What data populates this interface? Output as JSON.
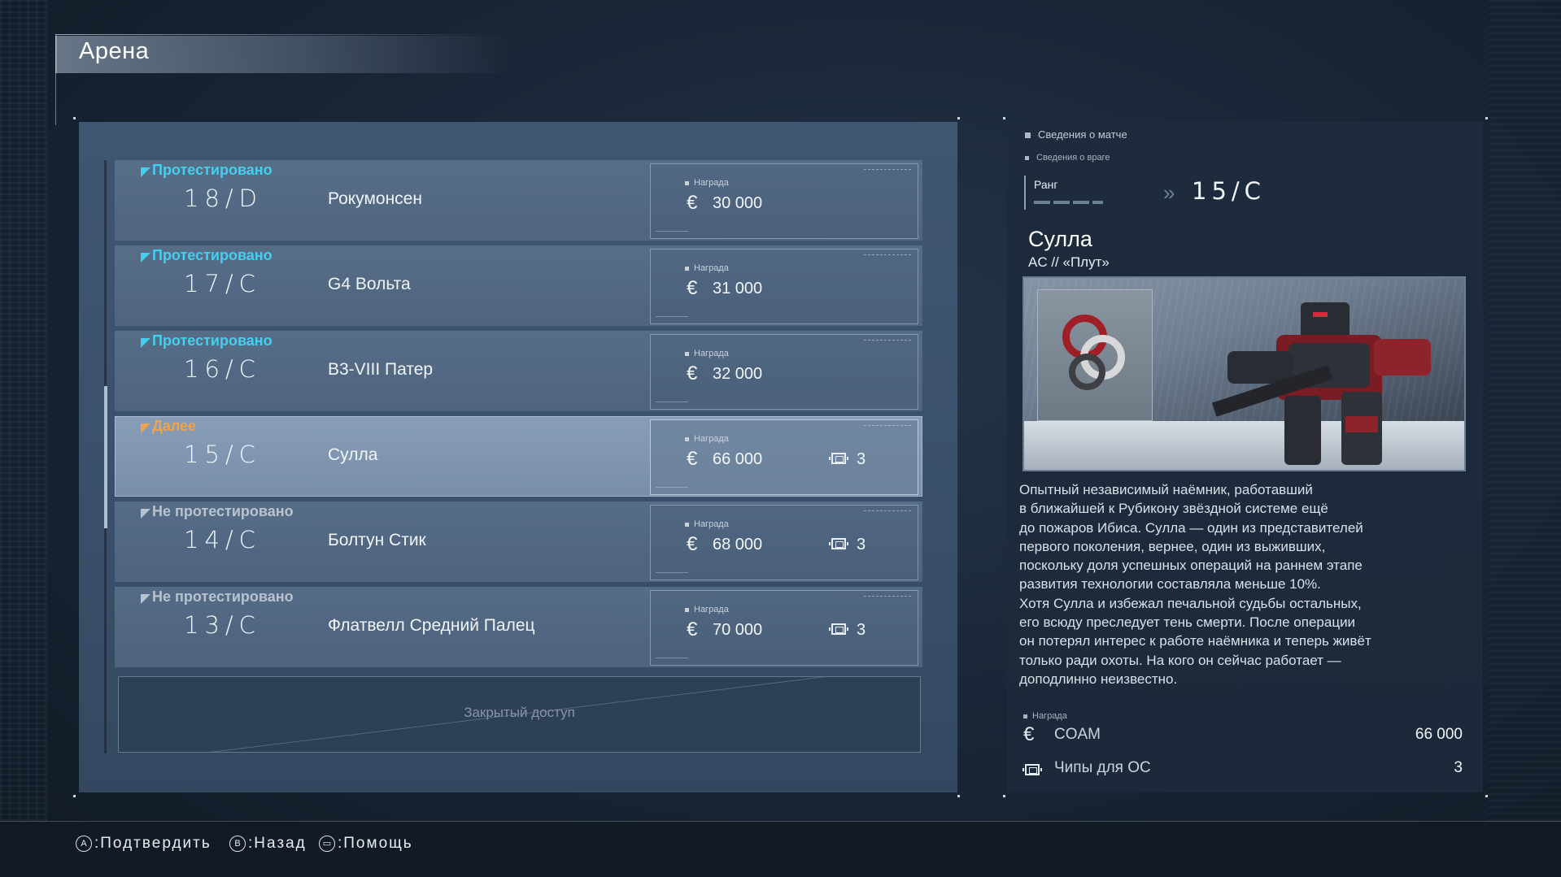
{
  "header": {
    "title": "Арена"
  },
  "arena_list": {
    "rows": [
      {
        "status": "Протестировано",
        "status_type": "tested",
        "rank": "18/D",
        "opponent": "Рокумонсен",
        "reward_label": "Награда",
        "reward": "30 000",
        "chips": ""
      },
      {
        "status": "Протестировано",
        "status_type": "tested",
        "rank": "17/C",
        "opponent": "G4 Вольта",
        "reward_label": "Награда",
        "reward": "31 000",
        "chips": ""
      },
      {
        "status": "Протестировано",
        "status_type": "tested",
        "rank": "16/C",
        "opponent": "В3-VIII Патер",
        "reward_label": "Награда",
        "reward": "32 000",
        "chips": ""
      },
      {
        "status": "Далее",
        "status_type": "next",
        "rank": "15/C",
        "opponent": "Сулла",
        "reward_label": "Награда",
        "reward": "66 000",
        "chips": "3"
      },
      {
        "status": "Не протестировано",
        "status_type": "untested",
        "rank": "14/C",
        "opponent": "Болтун Стик",
        "reward_label": "Награда",
        "reward": "68 000",
        "chips": "3"
      },
      {
        "status": "Не протестировано",
        "status_type": "untested",
        "rank": "13/C",
        "opponent": "Флатвелл Средний Палец",
        "reward_label": "Награда",
        "reward": "70 000",
        "chips": "3"
      }
    ],
    "locked_text": "Закрытый доступ",
    "selected_index": 3
  },
  "details": {
    "tab_match": "Сведения о матче",
    "tab_enemy": "Сведения о враге",
    "rank_label": "Ранг",
    "rank_value": "15/C",
    "pilot_name": "Сулла",
    "ac_line": "AC //  «Плут»",
    "description": "Опытный независимый наёмник, работавший\nв ближайшей к Рубикону звёздной системе ещё\nдо пожаров Ибиса. Сулла — один из представителей\nпервого поколения, вернее, один из выживших,\nпоскольку доля успешных операций на раннем этапе\nразвития технологии составляла меньше 10%.\nХотя Сулла и избежал печальной судьбы остальных,\nего всюду преследует тень смерти. После операции\nон потерял интерес к работе наёмника и теперь живёт\nтолько ради охоты. На кого он сейчас работает —\nдоподлинно неизвестно.",
    "reward_label": "Награда",
    "rewards": [
      {
        "icon": "coam-currency-icon",
        "label": "COAM",
        "value": "66 000"
      },
      {
        "icon": "chip-icon",
        "label": "Чипы для ОС",
        "value": "3"
      }
    ]
  },
  "footer": {
    "confirm": {
      "glyph": "A",
      "label": ":Подтвердить"
    },
    "back": {
      "glyph": "B",
      "label": ":Назад"
    },
    "help": {
      "glyph": "▭",
      "label": ":Помощь"
    }
  },
  "colors": {
    "tested": "#41d0ef",
    "next": "#f0a24c",
    "untested": "#b8c3cf",
    "panel": "#3f5671"
  }
}
